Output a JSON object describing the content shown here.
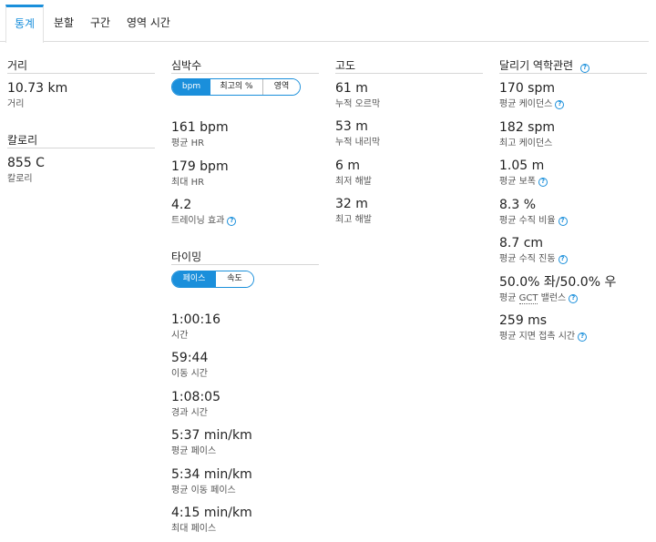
{
  "tabs": [
    {
      "label": "통계",
      "active": true
    },
    {
      "label": "분할",
      "active": false
    },
    {
      "label": "구간",
      "active": false
    },
    {
      "label": "영역 시간",
      "active": false
    }
  ],
  "distance": {
    "title": "거리",
    "value": "10.73 km",
    "label": "거리"
  },
  "calories": {
    "title": "칼로리",
    "value": "855 C",
    "label": "칼로리"
  },
  "heart_rate": {
    "title": "심박수",
    "toggle": [
      "bpm",
      "최고의 %",
      "영역"
    ],
    "stats": [
      {
        "value": "161 bpm",
        "label": "평균 HR"
      },
      {
        "value": "179 bpm",
        "label": "최대 HR"
      },
      {
        "value": "4.2",
        "label": "트레이닝 효과"
      }
    ]
  },
  "timing": {
    "title": "타이밍",
    "toggle": [
      "페이스",
      "속도"
    ],
    "stats": [
      {
        "value": "1:00:16",
        "label": "시간"
      },
      {
        "value": "59:44",
        "label": "이동 시간"
      },
      {
        "value": "1:08:05",
        "label": "경과 시간"
      },
      {
        "value": "5:37 min/km",
        "label": "평균 페이스"
      },
      {
        "value": "5:34 min/km",
        "label": "평균 이동 페이스"
      },
      {
        "value": "4:15 min/km",
        "label": "최대 페이스"
      }
    ]
  },
  "elevation": {
    "title": "고도",
    "stats": [
      {
        "value": "61 m",
        "label": "누적 오르막"
      },
      {
        "value": "53 m",
        "label": "누적 내리막"
      },
      {
        "value": "6 m",
        "label": "최저 해발"
      },
      {
        "value": "32 m",
        "label": "최고 해발"
      }
    ]
  },
  "dynamics": {
    "title": "달리기 역학관련",
    "stats": [
      {
        "value": "170 spm",
        "label": "평균 케이던스"
      },
      {
        "value": "182 spm",
        "label": "최고 케이던스"
      },
      {
        "value": "1.05 m",
        "label": "평균 보폭"
      },
      {
        "value": "8.3 %",
        "label": "평균 수직 비율"
      },
      {
        "value": "8.7 cm",
        "label": "평균 수직 진동"
      },
      {
        "value": "50.0% 좌/50.0% 우",
        "label_a": "평균 ",
        "label_b": "GCT",
        "label_c": " 밸런스"
      },
      {
        "value": "259 ms",
        "label": "평균 지면 접촉 시간"
      }
    ]
  },
  "colors": {
    "accent": "#1a8fdb"
  },
  "icons": {
    "help": "help-circle-icon"
  }
}
